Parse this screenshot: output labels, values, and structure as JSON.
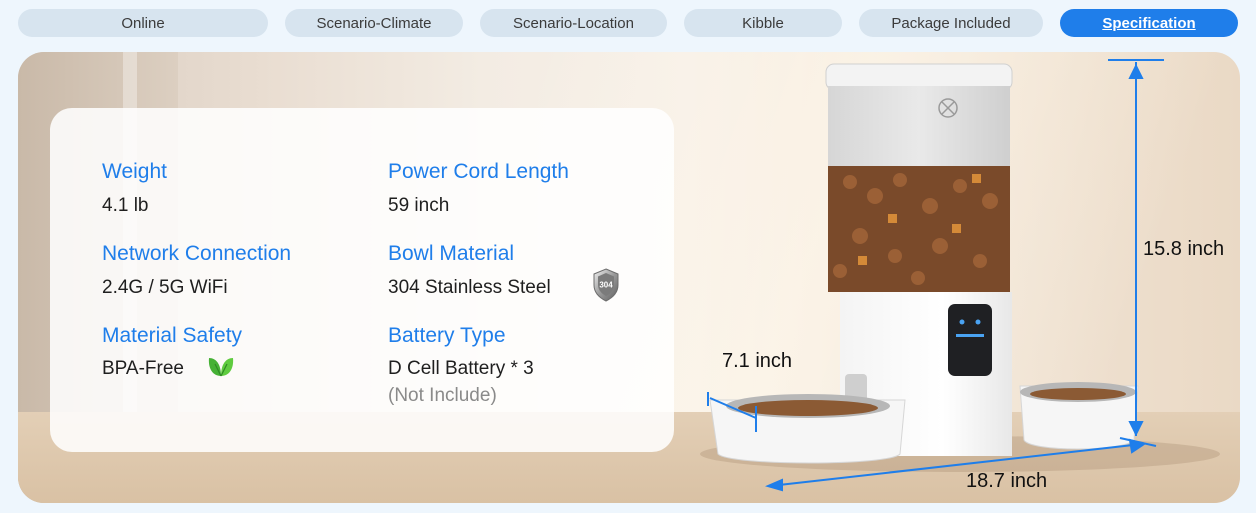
{
  "tabs": [
    {
      "label": "Online",
      "active": false
    },
    {
      "label": "Scenario-Climate",
      "active": false
    },
    {
      "label": "Scenario-Location",
      "active": false
    },
    {
      "label": "Kibble",
      "active": false
    },
    {
      "label": "Package Included",
      "active": false
    },
    {
      "label": "Specification",
      "active": true
    }
  ],
  "specs": {
    "weight": {
      "label": "Weight",
      "value": "4.1 lb"
    },
    "power_cord": {
      "label": "Power Cord Length",
      "value": "59 inch"
    },
    "network": {
      "label": "Network Connection",
      "value": "2.4G / 5G WiFi"
    },
    "bowl": {
      "label": "Bowl Material",
      "value": "304 Stainless Steel"
    },
    "safety": {
      "label": "Material Safety",
      "value": "BPA-Free"
    },
    "battery": {
      "label": "Battery Type",
      "value": "D Cell Battery * 3",
      "note": "(Not Include)"
    }
  },
  "badge_text": "304",
  "dimensions": {
    "height": "15.8 inch",
    "depth": "7.1 inch",
    "width": "18.7 inch"
  },
  "colors": {
    "accent": "#1f7eea",
    "leaf": "#46b135"
  },
  "icons": [
    "leaf-icon",
    "steel-304-badge-icon"
  ]
}
